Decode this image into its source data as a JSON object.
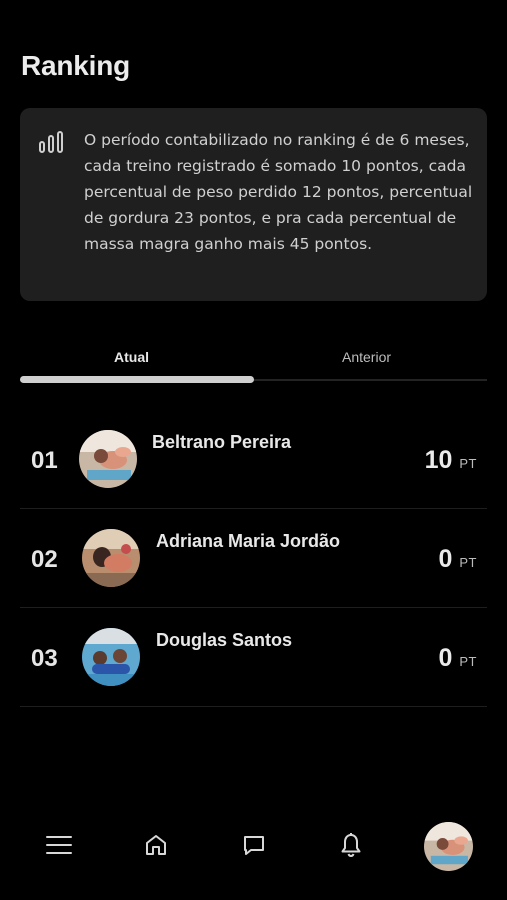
{
  "page": {
    "title": "Ranking"
  },
  "info": {
    "icon": "bar-chart-icon",
    "text": "O período contabilizado no ranking é de 6 meses, cada treino registrado é somado 10 pontos, cada percentual de peso perdido 12 pontos, percentual de gordura 23 pontos, e pra cada percentual de massa magra ganho mais 45 pontos."
  },
  "tabs": [
    {
      "label": "Atual",
      "active": true
    },
    {
      "label": "Anterior",
      "active": false
    }
  ],
  "ranking": [
    {
      "position": "01",
      "name": "Beltrano Pereira",
      "points": "10",
      "unit": "PT",
      "avatar": "avatar-photo-1"
    },
    {
      "position": "02",
      "name": "Adriana Maria Jordão",
      "points": "0",
      "unit": "PT",
      "avatar": "avatar-photo-2"
    },
    {
      "position": "03",
      "name": "Douglas Santos",
      "points": "0",
      "unit": "PT",
      "avatar": "avatar-photo-3"
    }
  ],
  "nav": {
    "items": [
      "menu-icon",
      "home-icon",
      "chat-icon",
      "bell-icon",
      "profile-avatar"
    ]
  },
  "colors": {
    "background": "#000000",
    "card": "#1f1f1f",
    "text": "#e6e6e6",
    "indicator": "#cfcfcf"
  }
}
